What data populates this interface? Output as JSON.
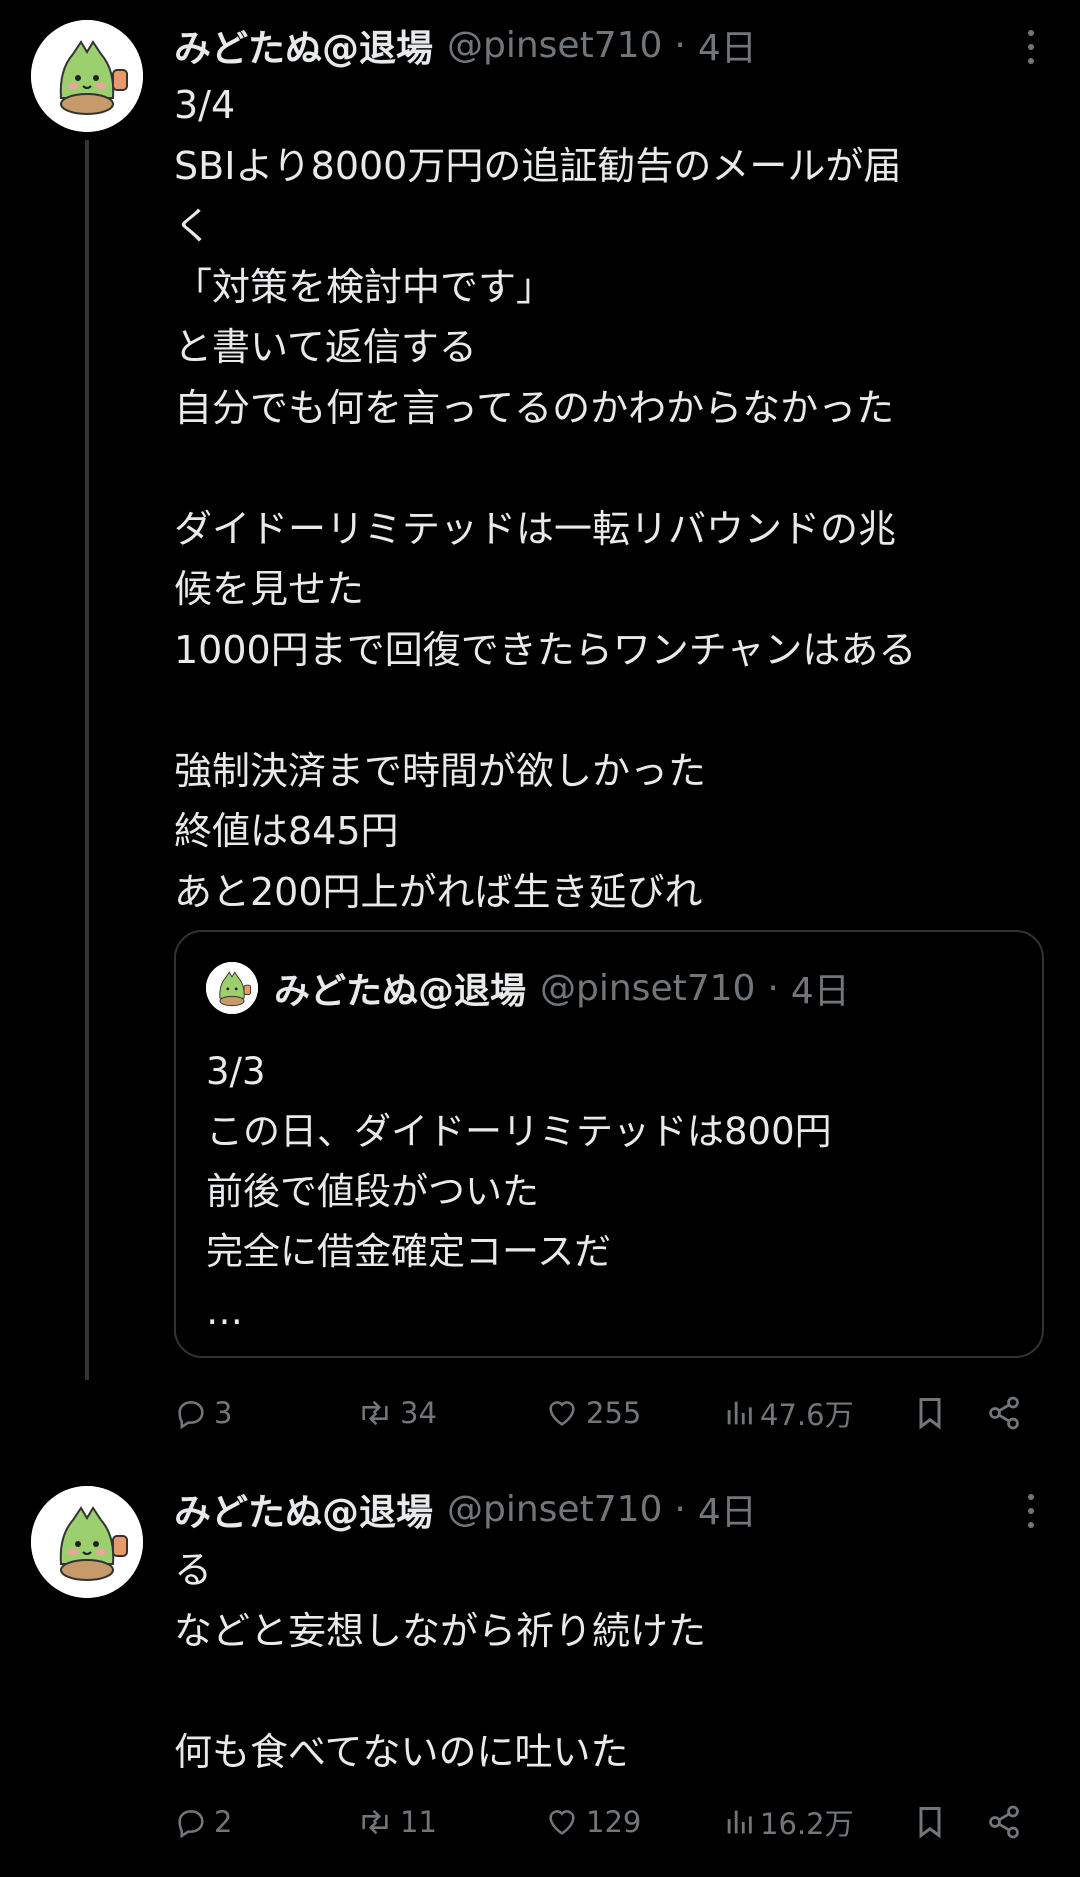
{
  "tweets": [
    {
      "author": {
        "name": "みどたぬ@退場",
        "handle": "@pinset710"
      },
      "separator": "·",
      "time": "4日",
      "lines": [
        "3/4",
        "SBIより8000万円の追証勧告のメールが届",
        "く",
        "「対策を検討中です」",
        "と書いて返信する",
        "自分でも何を言ってるのかわからなかった",
        "",
        "ダイドーリミテッドは一転リバウンドの兆",
        "候を見せた",
        "1000円まで回復できたらワンチャンはある",
        "",
        "強制決済まで時間が欲しかった",
        "終値は845円",
        "あと200円上がれば生き延びれ"
      ],
      "quote": {
        "author": {
          "name": "みどたぬ@退場",
          "handle": "@pinset710"
        },
        "separator": "·",
        "time": "4日",
        "lines": [
          "3/3",
          "この日、ダイドーリミテッドは800円",
          "前後で値段がついた",
          "完全に借金確定コースだ",
          "…"
        ]
      },
      "stats": {
        "replies": "3",
        "retweets": "34",
        "likes": "255",
        "views": "47.6万"
      }
    },
    {
      "author": {
        "name": "みどたぬ@退場",
        "handle": "@pinset710"
      },
      "separator": "·",
      "time": "4日",
      "lines": [
        "る",
        "などと妄想しながら祈り続けた",
        "",
        "何も食べてないのに吐いた"
      ],
      "stats": {
        "replies": "2",
        "retweets": "11",
        "likes": "129",
        "views": "16.2万"
      }
    }
  ],
  "icons": {
    "reply": "reply-icon",
    "retweet": "retweet-icon",
    "like": "heart-icon",
    "views": "views-icon",
    "bookmark": "bookmark-icon",
    "share": "share-icon",
    "more": "more-icon"
  },
  "colors": {
    "background": "#000000",
    "text": "#e7e9ea",
    "muted": "#71767b",
    "border": "#2f3336"
  }
}
